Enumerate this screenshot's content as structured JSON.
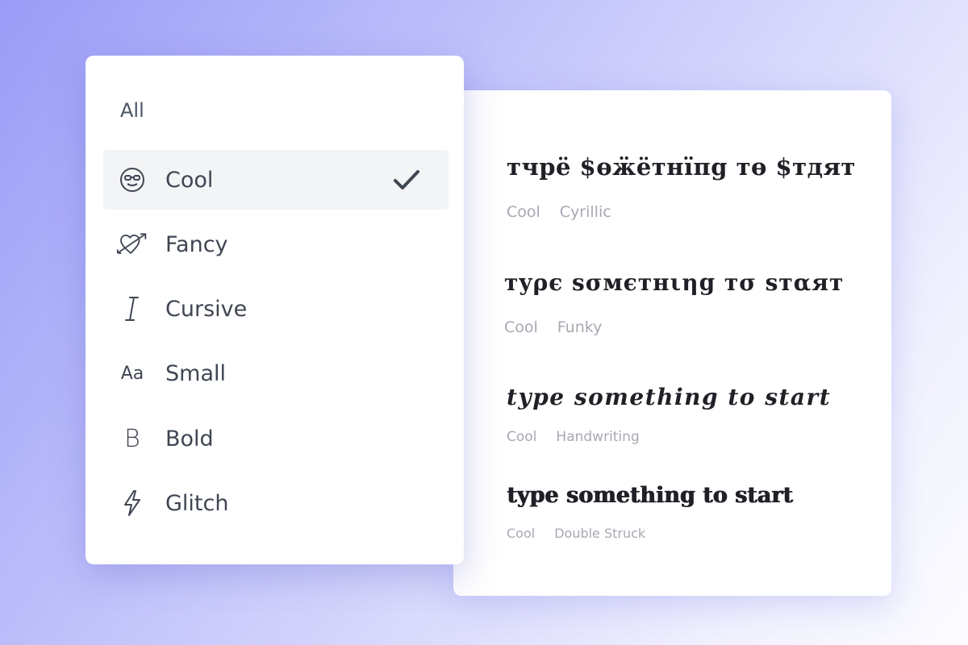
{
  "menu": {
    "all_label": "All",
    "items": [
      {
        "label": "Cool",
        "icon": "cool-sunglasses-face-icon",
        "selected": true
      },
      {
        "label": "Fancy",
        "icon": "heart-arrow-icon",
        "selected": false
      },
      {
        "label": "Cursive",
        "icon": "italic-i-icon",
        "selected": false
      },
      {
        "label": "Small",
        "icon": "small-letters-icon",
        "icon_text": "Aa",
        "selected": false
      },
      {
        "label": "Bold",
        "icon": "bold-b-icon",
        "icon_text": "B",
        "selected": false
      },
      {
        "label": "Glitch",
        "icon": "lightning-bolt-icon",
        "selected": false
      }
    ],
    "selected_check_icon": "checkmark-icon"
  },
  "results": [
    {
      "preview": "тчрё $өӝётнїпg тө $тдят",
      "tags": [
        "Cool",
        "Cyrillic"
      ]
    },
    {
      "preview": "тyρє ѕσмєтнιηg тσ ѕтαят",
      "tags": [
        "Cool",
        "Funky"
      ]
    },
    {
      "preview": "type something to start",
      "tags": [
        "Cool",
        "Handwriting"
      ]
    },
    {
      "preview": "type something to start",
      "tags": [
        "Cool",
        "Double Struck"
      ]
    }
  ],
  "colors": {
    "background_start": "#9a9cf7",
    "background_end": "#fbfbff",
    "selected_row_bg": "#f3f4f6",
    "label_text": "#3f4652",
    "tag_text": "#a7a9b3"
  }
}
